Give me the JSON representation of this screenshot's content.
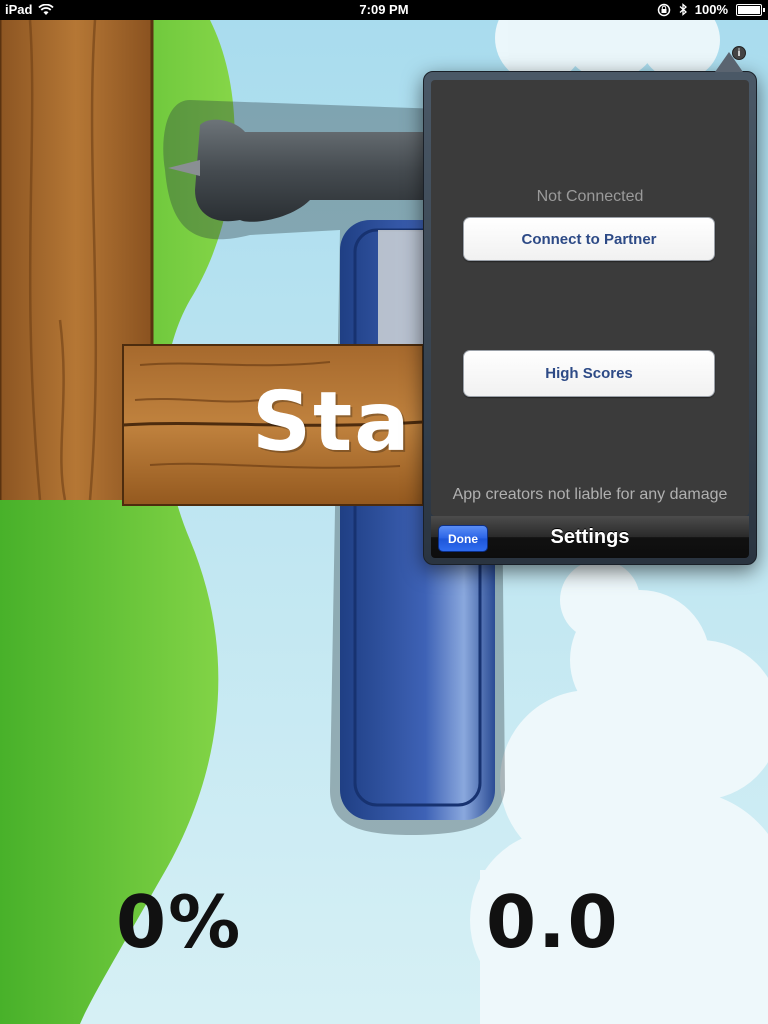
{
  "status_bar": {
    "device": "iPad",
    "time": "7:09 PM",
    "battery": "100%"
  },
  "icons": {
    "wifi": "wifi-icon",
    "lock_rotation": "rotation-lock-icon",
    "bluetooth": "bluetooth-icon",
    "battery": "battery-icon",
    "info": "info-icon"
  },
  "game": {
    "start_sign": "Sta",
    "percent": "0%",
    "score": "0.0"
  },
  "settings_popover": {
    "connection_status": "Not Connected",
    "connect_button": "Connect to Partner",
    "high_scores_button": "High Scores",
    "disclaimer": "App creators not liable for any damage",
    "done_button": "Done",
    "title": "Settings"
  },
  "colors": {
    "sky": "#bfe3ee",
    "grass": "#6cc63a",
    "wood": "#a0662e",
    "done_blue": "#2a63e6",
    "button_text": "#2d4a86"
  }
}
